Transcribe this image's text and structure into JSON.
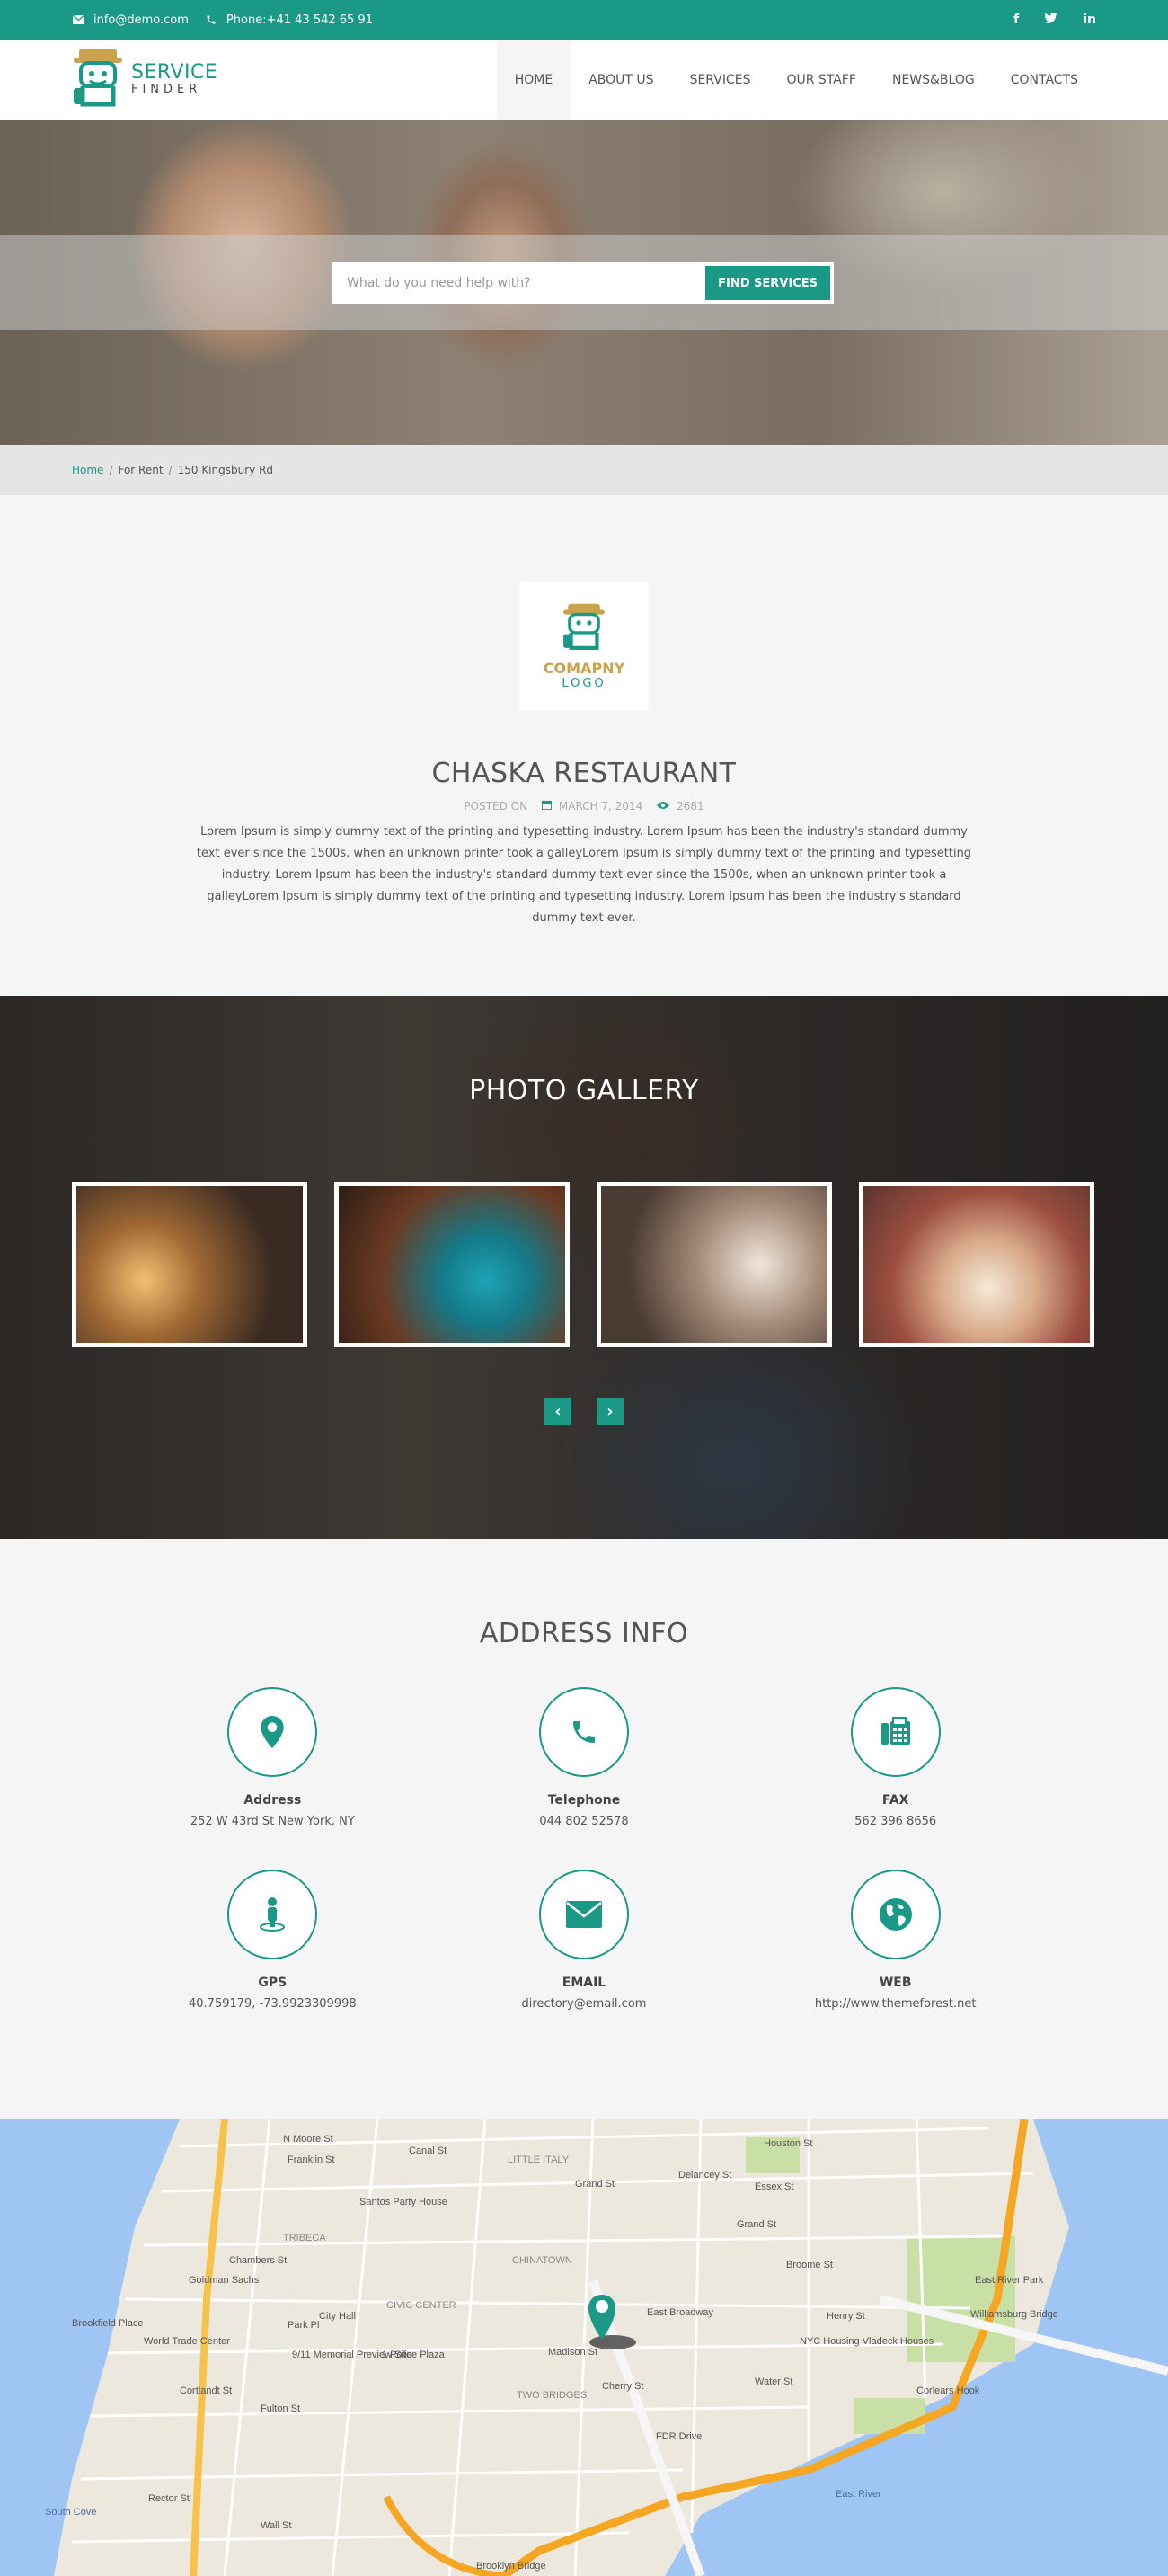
{
  "topbar": {
    "email": "info@demo.com",
    "phone": "Phone:+41 43 542 65 91",
    "social": [
      {
        "name": "facebook-icon",
        "glyph": "f"
      },
      {
        "name": "twitter-icon",
        "glyph": "t"
      },
      {
        "name": "linkedin-icon",
        "glyph": "in"
      }
    ]
  },
  "header": {
    "logo_title": "SERVICE",
    "logo_sub": "FINDER",
    "nav": [
      "HOME",
      "ABOUT US",
      "SERVICES",
      "OUR STAFF",
      "NEWS&BLOG",
      "CONTACTS"
    ],
    "active_nav": "HOME"
  },
  "search": {
    "placeholder": "What do you need help with?",
    "button": "FIND SERVICES"
  },
  "breadcrumb": {
    "home": "Home",
    "sep1": "/",
    "item2": "For Rent",
    "sep2": "/",
    "current": "150 Kingsbury Rd"
  },
  "detail": {
    "logo_line1": "COMAPNY",
    "logo_line2": "LOGO",
    "title": "CHASKA RESTAURANT",
    "posted_label": "POSTED ON",
    "date": "MARCH 7, 2014",
    "views": "2681",
    "description": "Lorem Ipsum is simply dummy text of the printing and typesetting industry. Lorem Ipsum has been the industry's standard dummy text ever since the 1500s, when an unknown printer took a galleyLorem Ipsum is simply dummy text of the printing and typesetting industry. Lorem Ipsum has been the industry's standard dummy text ever since the 1500s, when an unknown printer took a galleyLorem Ipsum is simply dummy text of the printing and typesetting industry. Lorem Ipsum has been the industry's standard dummy text ever."
  },
  "gallery": {
    "title": "PHOTO GALLERY",
    "prev": "‹",
    "next": "›"
  },
  "address": {
    "title": "ADDRESS INFO",
    "items": [
      {
        "label": "Address",
        "value": "252 W 43rd St New York, NY",
        "icon": "map-pin-icon"
      },
      {
        "label": "Telephone",
        "value": "044 802 52578",
        "icon": "phone-icon"
      },
      {
        "label": "FAX",
        "value": "562 396 8656",
        "icon": "fax-icon"
      },
      {
        "label": "GPS",
        "value": "40.759179, -73.9923309998",
        "icon": "gps-person-icon"
      },
      {
        "label": "EMAIL",
        "value": "directory@email.com",
        "icon": "envelope-icon"
      },
      {
        "label": "WEB",
        "value": "http://www.themeforest.net",
        "icon": "globe-icon"
      }
    ]
  },
  "map": {
    "labels": [
      "N Moore St",
      "Franklin St",
      "Canal St",
      "LITTLE ITALY",
      "Grand St",
      "Delancey St",
      "Essex St",
      "Broome St",
      "Santos Party House",
      "TRIBECA",
      "Chambers St",
      "Goldman Sachs",
      "CIVIC CENTER",
      "CHINATOWN",
      "World Trade Center",
      "9/11 Memorial Preview Site",
      "1 Police Plaza",
      "East Broadway",
      "Madison St",
      "NYC Housing Vladeck Houses",
      "TWO BRIDGES",
      "FDR Drive",
      "Williamsburg Bridge",
      "East River Park",
      "East River",
      "Brooklyn Bridge",
      "South Cove",
      "Corlears Hook",
      "Water St",
      "Cherry St",
      "Fulton St",
      "Wall St",
      "Rector St",
      "Cortlandt St",
      "City Hall",
      "Park Pl",
      "Brookfield Place",
      "Henry St",
      "Grand St",
      "Houston St"
    ]
  }
}
